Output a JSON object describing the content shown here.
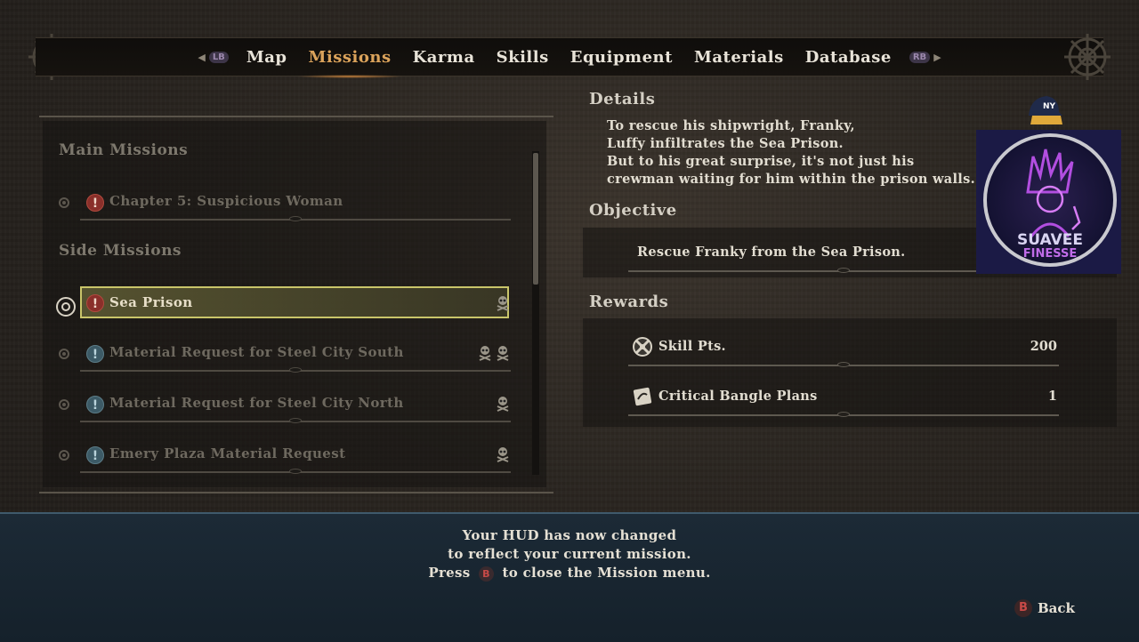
{
  "nav": {
    "prev_button": "LB",
    "next_button": "RB",
    "tabs": [
      {
        "label": "Map",
        "active": false
      },
      {
        "label": "Missions",
        "active": true
      },
      {
        "label": "Karma",
        "active": false
      },
      {
        "label": "Skills",
        "active": false
      },
      {
        "label": "Equipment",
        "active": false
      },
      {
        "label": "Materials",
        "active": false
      },
      {
        "label": "Database",
        "active": false
      }
    ]
  },
  "missions": {
    "main_title": "Main Missions",
    "side_title": "Side Missions",
    "main": [
      {
        "label": "Chapter 5: Suspicious Woman",
        "mark": "!",
        "mark_color": "red",
        "skulls": 0
      }
    ],
    "side": [
      {
        "label": "Sea Prison",
        "mark": "!",
        "mark_color": "red",
        "skulls": 1,
        "selected": true
      },
      {
        "label": "Material Request for Steel City South",
        "mark": "!",
        "mark_color": "blue",
        "skulls": 2
      },
      {
        "label": "Material Request for Steel City North",
        "mark": "!",
        "mark_color": "blue",
        "skulls": 1
      },
      {
        "label": "Emery Plaza Material Request",
        "mark": "!",
        "mark_color": "blue",
        "skulls": 1
      }
    ]
  },
  "details": {
    "heading": "Details",
    "lines": [
      "To rescue his shipwright, Franky,",
      "Luffy infiltrates the Sea Prison.",
      "But to his great surprise, it's not just his",
      "crewman waiting for him within the prison walls."
    ]
  },
  "objective": {
    "heading": "Objective",
    "text": "Rescue Franky from the Sea Prison."
  },
  "rewards": {
    "heading": "Rewards",
    "items": [
      {
        "label": "Skill Pts.",
        "value": "200",
        "icon": "skill-points-icon"
      },
      {
        "label": "Critical Bangle Plans",
        "value": "1",
        "icon": "blueprint-icon"
      }
    ]
  },
  "notice": {
    "line1": "Your HUD has now changed",
    "line2": "to reflect your current mission.",
    "line3_pre": "Press",
    "line3_post": "to close the Mission menu.",
    "button": "B"
  },
  "back": {
    "button": "B",
    "label": "Back"
  },
  "watermark": {
    "line1": "SUAVEE",
    "line2": "FINESSE"
  },
  "colors": {
    "accent": "#dba35b",
    "selection": "#c9c56a",
    "bottom_bar": "#1c2a36"
  }
}
